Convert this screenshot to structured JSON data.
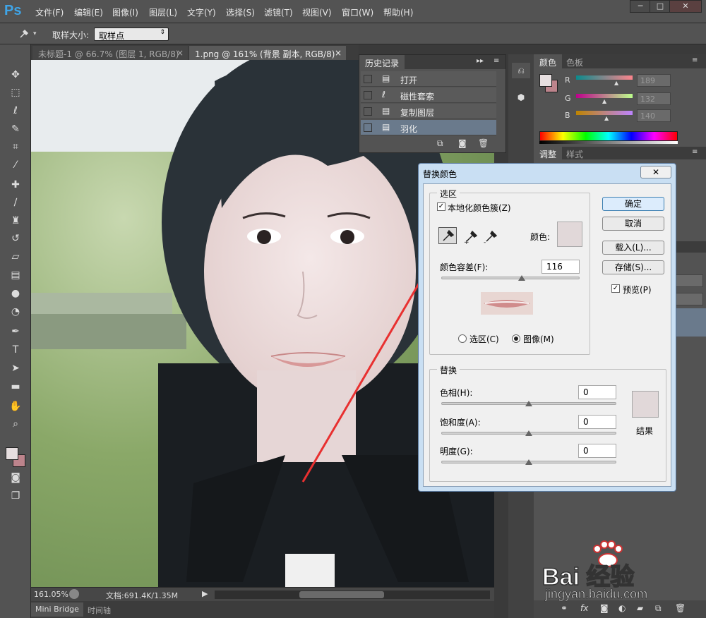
{
  "app": {
    "logo": "Ps"
  },
  "menu": [
    "文件(F)",
    "编辑(E)",
    "图像(I)",
    "图层(L)",
    "文字(Y)",
    "选择(S)",
    "滤镜(T)",
    "视图(V)",
    "窗口(W)",
    "帮助(H)"
  ],
  "window_controls": {
    "minimize": "─",
    "maximize": "□",
    "close": "✕"
  },
  "options_bar": {
    "sample_size_label": "取样大小:",
    "sample_size_value": "取样点"
  },
  "doc_tabs": [
    {
      "title": "未标题-1 @ 66.7% (图层 1, RGB/8) *",
      "close": "×"
    },
    {
      "title": "1.png @ 161% (背景 副本, RGB/8) *",
      "close": "×"
    }
  ],
  "status": {
    "zoom": "161.05%",
    "doc_info": "文档:691.4K/1.35M"
  },
  "bottom_tabs": [
    "Mini Bridge",
    "时间轴"
  ],
  "history": {
    "title": "历史记录",
    "items": [
      "打开",
      "磁性套索",
      "复制图层",
      "羽化"
    ],
    "selected_index": 3
  },
  "color_panel": {
    "tabs": [
      "颜色",
      "色板"
    ],
    "channels": [
      {
        "label": "R",
        "value": "189"
      },
      {
        "label": "G",
        "value": "132"
      },
      {
        "label": "B",
        "value": "140"
      }
    ],
    "colors": {
      "foreground": "#e6dedf",
      "background": "#bd848c"
    }
  },
  "adjust_panel": {
    "tabs": [
      "调整",
      "样式"
    ]
  },
  "dialog": {
    "title": "替换颜色",
    "close_label": "✕",
    "selection_group": "选区",
    "localized_label": "本地化颜色簇(Z)",
    "localized_checked": true,
    "color_label": "颜色:",
    "fuzziness_label": "颜色容差(F):",
    "fuzziness_value": "116",
    "fuzziness": 116,
    "fuzziness_max": 200,
    "radio_selection": "选区(C)",
    "radio_image": "图像(M)",
    "radio_selected": "image",
    "replace_group": "替换",
    "hue_label": "色相(H):",
    "hue_value": "0",
    "saturation_label": "饱和度(A):",
    "saturation_value": "0",
    "lightness_label": "明度(G):",
    "lightness_value": "0",
    "result_label": "结果",
    "buttons": {
      "ok": "确定",
      "cancel": "取消",
      "load": "载入(L)...",
      "save": "存储(S)..."
    },
    "preview_label": "预览(P)",
    "preview_checked": true,
    "swatch_color": "#e1d8d9"
  },
  "watermark": {
    "text": "Bai 经验",
    "url": "jingyan.baidu.com"
  }
}
